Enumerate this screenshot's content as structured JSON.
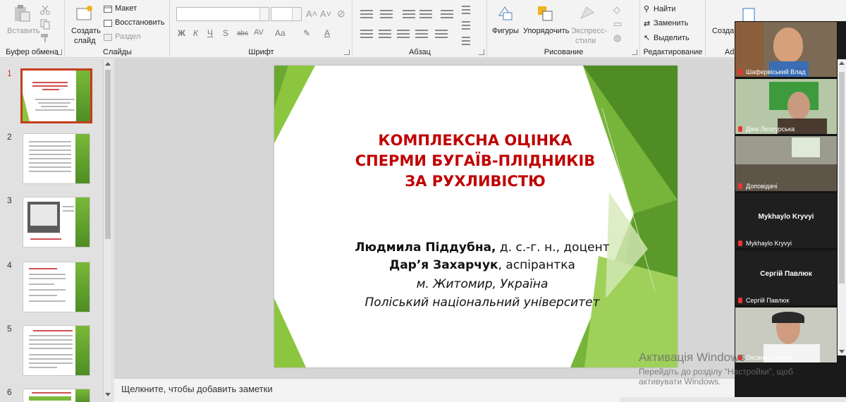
{
  "ribbon": {
    "clipboard": {
      "label": "Буфер обмена",
      "paste": "Вставить"
    },
    "slides": {
      "label": "Слайды",
      "new_slide_1": "Создать",
      "new_slide_2": "слайд",
      "layout": "Макет",
      "reset": "Восстановить",
      "section": "Раздел"
    },
    "font": {
      "label": "Шрифт",
      "bold": "Ж",
      "italic": "К",
      "underline": "Ч",
      "strike": "S",
      "spacing": "abc",
      "case": "AV",
      "size_case": "Aa"
    },
    "paragraph": {
      "label": "Абзац"
    },
    "drawing": {
      "label": "Рисование",
      "shapes": "Фигуры",
      "arrange": "Упорядочить",
      "quick_styles_1": "Экспресс-",
      "quick_styles_2": "стили"
    },
    "editing": {
      "label": "Редактирование",
      "find": "Найти",
      "replace": "Заменить",
      "select": "Выделить"
    },
    "create": {
      "label": "Созда",
      "addin": "Ad"
    }
  },
  "thumbnails": [
    {
      "num": "1"
    },
    {
      "num": "2"
    },
    {
      "num": "3"
    },
    {
      "num": "4"
    },
    {
      "num": "5"
    },
    {
      "num": "6"
    }
  ],
  "slide": {
    "title_1": "КОМПЛЕКСНА ОЦІНКА",
    "title_2": "СПЕРМИ БУГАЇВ-ПЛІДНИКІВ",
    "title_3": "ЗА РУХЛИВІСТЮ",
    "author1_name": "Людмила Піддубна,",
    "author1_rest": " д. с.-г. н., доцент",
    "author2_name": "Дар’я Захарчук",
    "author2_rest": ", аспірантка",
    "city": "м. Житомир, Україна",
    "university": "Поліський національний університет"
  },
  "notes": {
    "placeholder": "Щелкните, чтобы добавить заметки"
  },
  "participants": [
    {
      "name": "Шафервіський Влад"
    },
    {
      "name": "Діна Лісогурська"
    },
    {
      "name": "Доповідачі"
    },
    {
      "name": "Mykhaylo Kryvyi",
      "display": "Mykhaylo Kryvyi"
    },
    {
      "name": "Сергій Павлюк",
      "display": "Сергій Павлюк"
    },
    {
      "name": "Оксана Січенко"
    }
  ],
  "watermark": {
    "line1": "Активація Windows",
    "line2": "Перейдіть до розділу \"Настройки\", щоб",
    "line3": "активувати Windows."
  },
  "colors": {
    "title_red": "#c00000",
    "accent_green": "#8cc63f",
    "selection": "#c43e1c"
  }
}
